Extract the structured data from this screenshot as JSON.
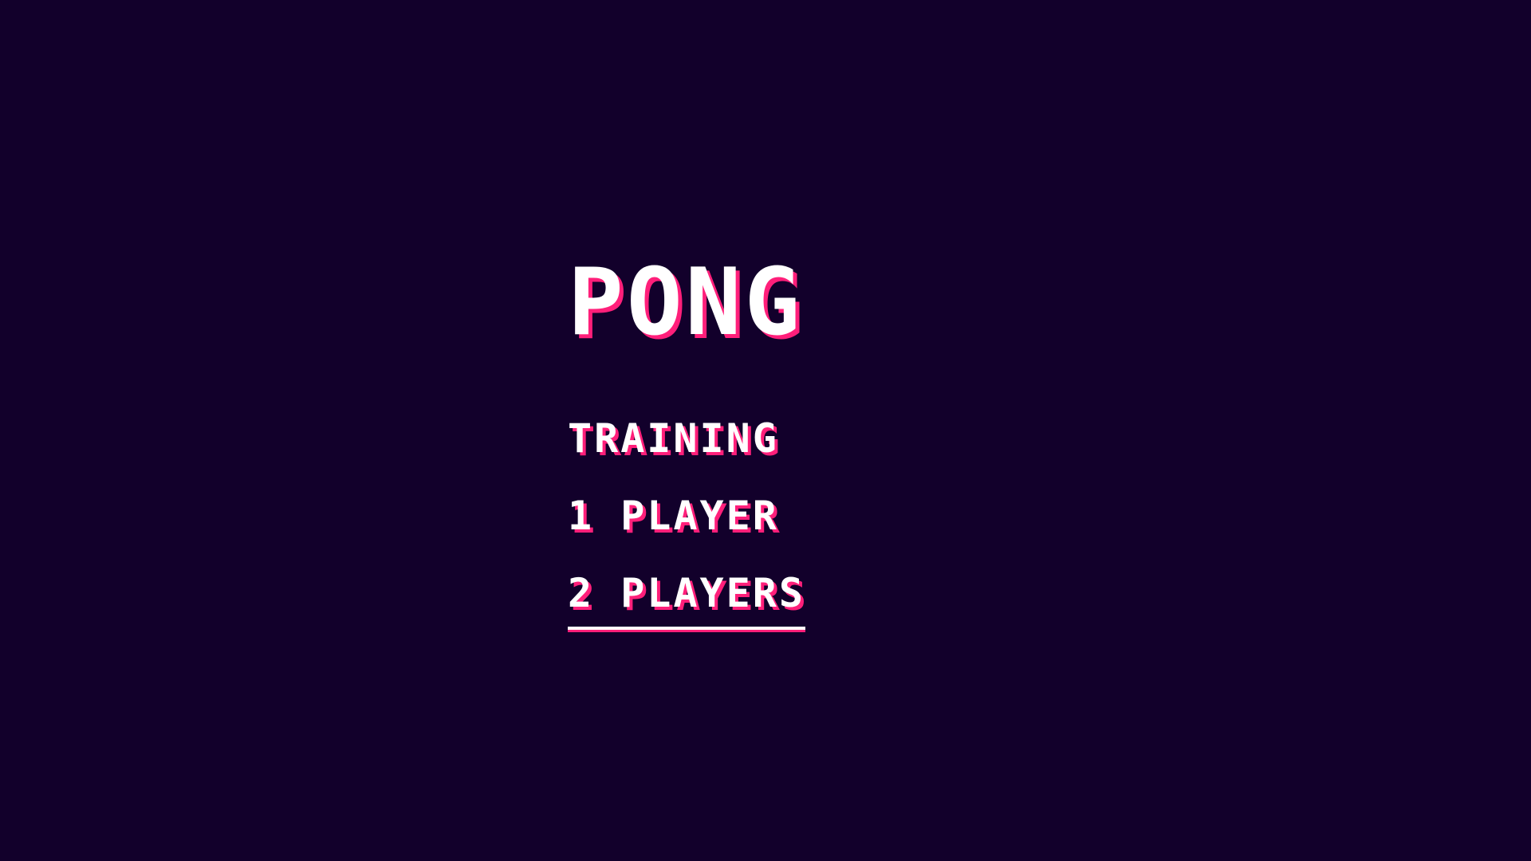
{
  "game": {
    "title": "PONG",
    "menu": [
      {
        "label": "TRAINING",
        "selected": false
      },
      {
        "label": "1 PLAYER",
        "selected": false
      },
      {
        "label": "2 PLAYERS",
        "selected": true
      }
    ]
  },
  "colors": {
    "background": "#12002b",
    "text": "#ffffff",
    "accent_shadow": "#ff1f7a"
  }
}
